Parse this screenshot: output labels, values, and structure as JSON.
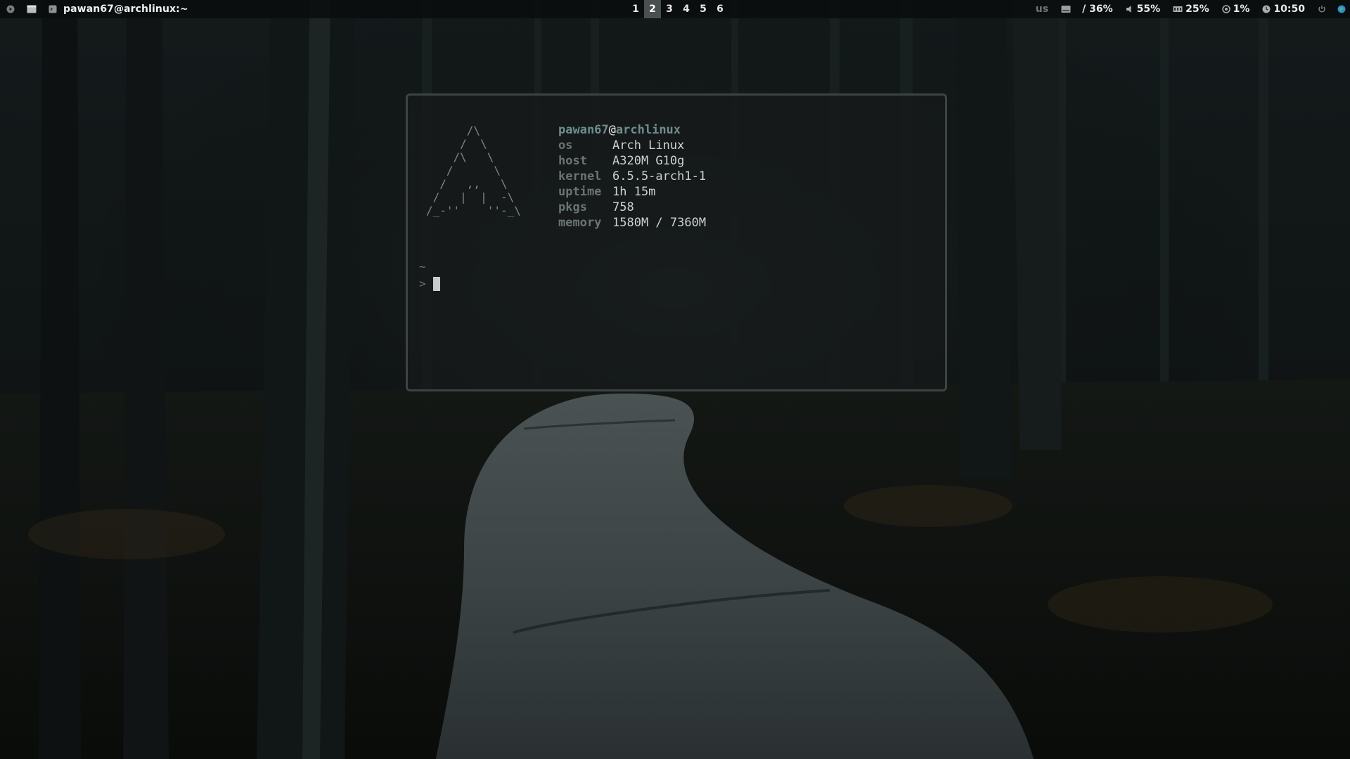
{
  "topbar": {
    "window_title": "pawan67@archlinux:~",
    "left_icons": [
      "power-menu-icon",
      "window-layout-icon",
      "terminal-app-icon"
    ],
    "workspaces": [
      "1",
      "2",
      "3",
      "4",
      "5",
      "6"
    ],
    "active_workspace": "2",
    "modules": {
      "keyboard_layout": "us",
      "disk": "/ 36%",
      "volume": "55%",
      "memory": "25%",
      "cpu": "1%",
      "clock": "10:50"
    }
  },
  "terminal": {
    "logo_lines": [
      "      /\\",
      "     /  \\",
      "    /\\   \\",
      "   /      \\",
      "  /   ,,   \\",
      " /   |  |  -\\",
      "/_-''    ''-_\\"
    ],
    "user": "pawan67",
    "at": "@",
    "hostname": "archlinux",
    "info": [
      {
        "key": "os",
        "value": "Arch Linux"
      },
      {
        "key": "host",
        "value": "A320M G10g"
      },
      {
        "key": "kernel",
        "value": "6.5.5-arch1-1"
      },
      {
        "key": "uptime",
        "value": "1h 15m"
      },
      {
        "key": "pkgs",
        "value": "758"
      },
      {
        "key": "memory",
        "value": "1580M / 7360M"
      }
    ],
    "prompt_dir": "~",
    "prompt_symbol": ">"
  },
  "colors": {
    "accent": "#6f8e8e",
    "active_workspace_bg": "#4a4f50",
    "terminal_border": "#3d4344"
  }
}
